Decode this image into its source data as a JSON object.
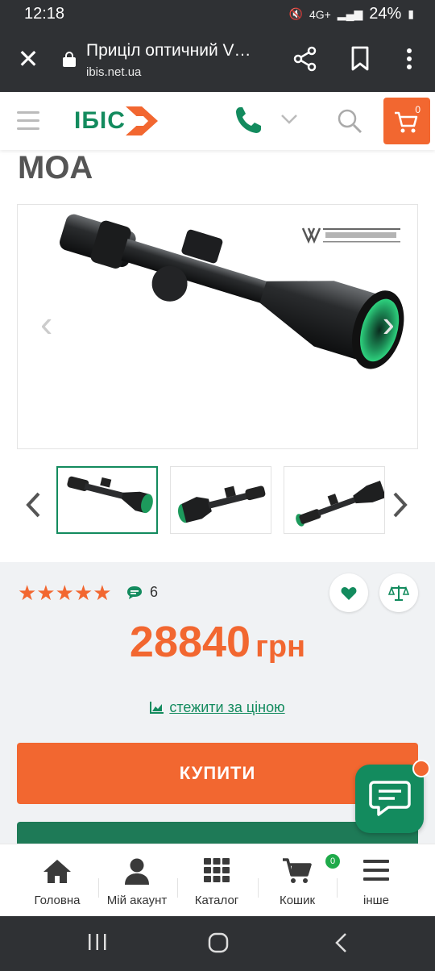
{
  "status_bar": {
    "time": "12:18",
    "battery": "24%",
    "network": "4G+"
  },
  "browser": {
    "tab_title": "Приціл оптичний V…",
    "url": "ibis.net.ua"
  },
  "site": {
    "logo_text": "ІБІС",
    "cart_count": "0"
  },
  "product": {
    "title_tail": "MOA",
    "rating_stars": "★★★★★",
    "review_count": "6",
    "price_value": "28840",
    "price_currency": "грн",
    "watch_price_link": "стежити за ціною",
    "buy_button": "КУПИТИ",
    "gallery": {
      "prev_icon": "‹",
      "next_icon": "›"
    },
    "brand_watermark": "VORTEX The Force of Optics"
  },
  "bottom_nav": {
    "items": [
      {
        "label": "Головна",
        "icon": "home-icon"
      },
      {
        "label": "Мій акаунт",
        "icon": "user-icon"
      },
      {
        "label": "Каталог",
        "icon": "grid-icon"
      },
      {
        "label": "Кошик",
        "icon": "cart-icon",
        "badge": "0"
      },
      {
        "label": "інше",
        "icon": "menu-icon"
      }
    ]
  },
  "colors": {
    "brand_green": "#138b5e",
    "accent_orange": "#f26730",
    "dark_bar": "#2f3134"
  }
}
